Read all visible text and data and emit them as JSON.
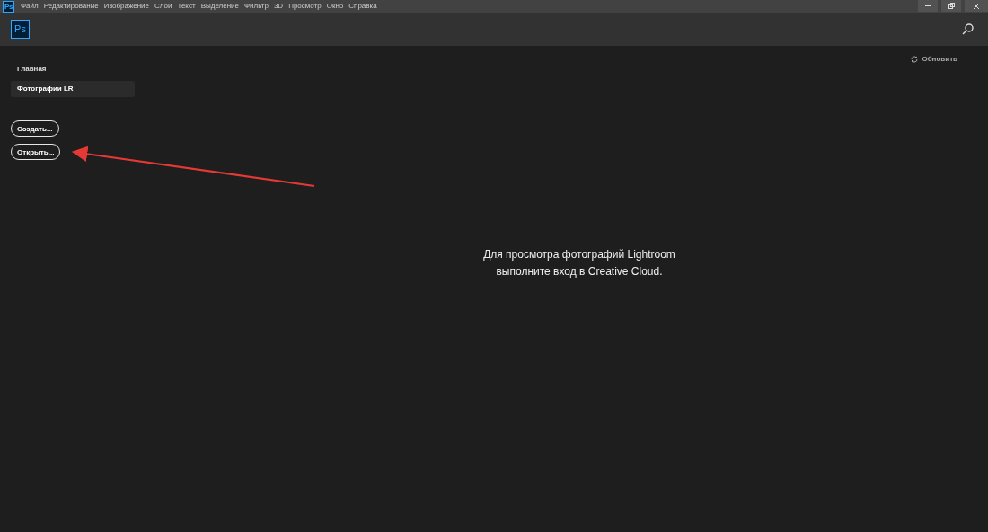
{
  "window": {
    "icon_label": "Ps"
  },
  "menu_bar": {
    "items": [
      "Файл",
      "Редактирование",
      "Изображение",
      "Слои",
      "Текст",
      "Выделение",
      "Фильтр",
      "3D",
      "Просмотр",
      "Окно",
      "Справка"
    ]
  },
  "header": {
    "logo": "Ps"
  },
  "refresh": {
    "label": "Обновить"
  },
  "sidebar": {
    "items": [
      {
        "label": "Главная",
        "selected": false
      },
      {
        "label": "Фотографии LR",
        "selected": true
      }
    ]
  },
  "buttons": [
    "Создать...",
    "Открыть..."
  ],
  "message": {
    "lines": [
      "Для просмотра фотографий Lightroom",
      "выполните вход в Creative Cloud."
    ]
  }
}
